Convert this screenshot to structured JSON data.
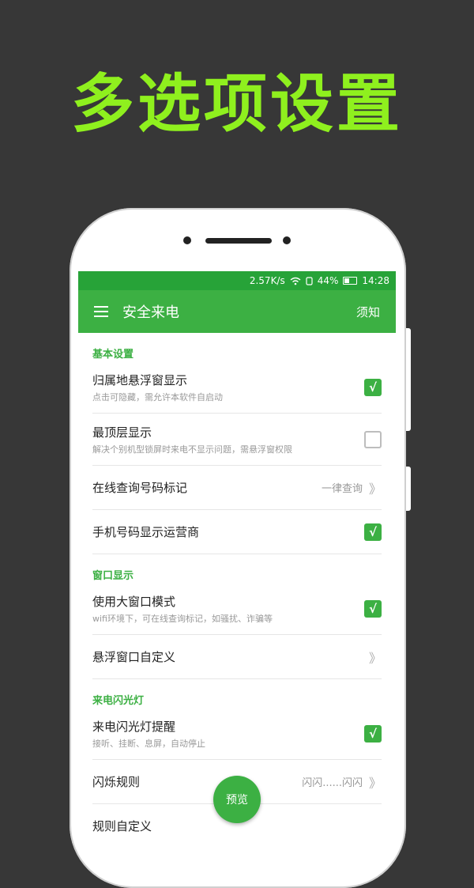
{
  "promo": {
    "title": "多选项设置"
  },
  "status": {
    "speed": "2.57K/s",
    "battery": "44%",
    "time": "14:28"
  },
  "app_bar": {
    "title": "安全来电",
    "notice": "须知"
  },
  "sections": [
    {
      "title": "基本设置",
      "rows": [
        {
          "title": "归属地悬浮窗显示",
          "subtitle": "点击可隐藏，需允许本软件自启动",
          "checked": true
        },
        {
          "title": "最顶层显示",
          "subtitle": "解决个别机型锁屏时来电不显示问题，需悬浮窗权限",
          "checked": false
        },
        {
          "title": "在线查询号码标记",
          "value": "一律查询"
        },
        {
          "title": "手机号码显示运营商",
          "checked": true
        }
      ]
    },
    {
      "title": "窗口显示",
      "rows": [
        {
          "title": "使用大窗口模式",
          "subtitle": "wifi环境下，可在线查询标记，如骚扰、诈骗等",
          "checked": true
        },
        {
          "title": "悬浮窗口自定义"
        }
      ]
    },
    {
      "title": "来电闪光灯",
      "rows": [
        {
          "title": "来电闪光灯提醒",
          "subtitle": "接听、挂断、息屏，自动停止",
          "checked": true
        },
        {
          "title": "闪烁规则",
          "value": "闪闪......闪闪"
        },
        {
          "title": "规则自定义"
        }
      ]
    }
  ],
  "fab": {
    "label": "预览"
  },
  "glyphs": {
    "check": "√",
    "arrow": "》"
  },
  "colors": {
    "accent": "#3cb043",
    "status_bar": "#27a338",
    "promo": "#8ff01e"
  }
}
